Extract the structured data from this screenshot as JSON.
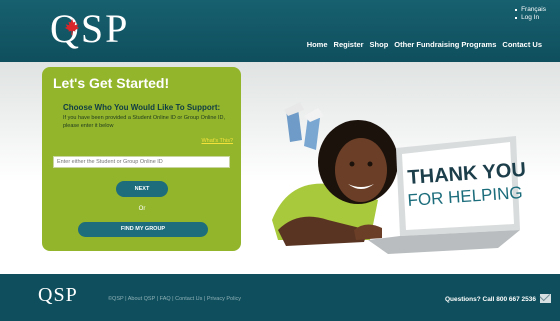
{
  "header": {
    "logo_text": "QSP",
    "lang_link": "Français",
    "login_link": "Log In",
    "nav": [
      "Home",
      "Register",
      "Shop",
      "Other Fundraising Programs",
      "Contact Us"
    ]
  },
  "panel": {
    "title": "Let's Get Started!",
    "choose": "Choose Who You Would Like To Support:",
    "note": "If you have been provided a Student Online ID or Group Online ID, please enter it below",
    "whats_link": "What's This?",
    "input_placeholder": "Enter either the Student or Group Online ID",
    "next_label": "NEXT",
    "or_text": "Or",
    "find_label": "FIND MY GROUP"
  },
  "hero": {
    "line1": "THANK YOU",
    "line2": "FOR HELPING"
  },
  "footer": {
    "logo_text": "QSP",
    "links": "©QSP | About QSP | FAQ | Contact Us | Privacy Policy",
    "questions": "Questions? Call 800 667 2536"
  },
  "colors": {
    "teal": "#0f4f5d",
    "green_panel": "#93b52b",
    "button": "#1d6d7c",
    "yellow_link": "#f4e23b"
  }
}
